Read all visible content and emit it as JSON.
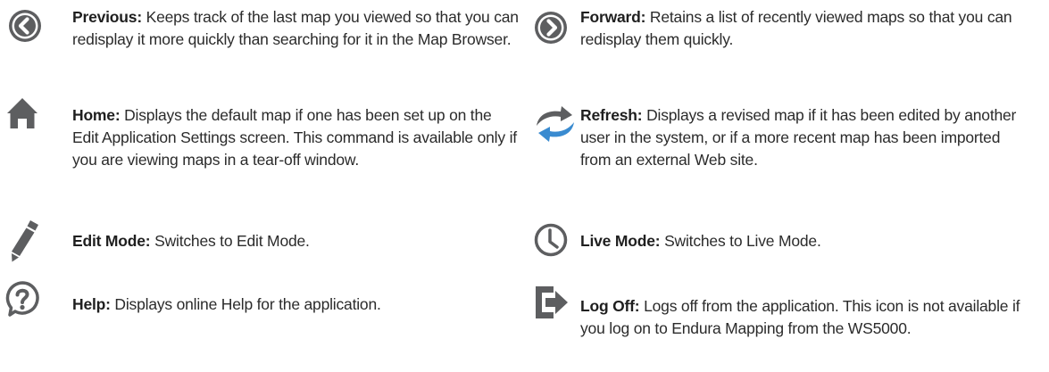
{
  "colors": {
    "icon": "#5d5e60",
    "text": "#2b2b2b"
  },
  "entries": [
    {
      "icon": "arrow-left-circle-icon",
      "term": "Previous:",
      "desc": " Keeps track of the last map you viewed so that you can redisplay it more quickly than searching for it in the Map Browser."
    },
    {
      "icon": "arrow-right-circle-icon",
      "term": "Forward:",
      "desc": " Retains a list of recently viewed maps so that you can redisplay them quickly."
    },
    {
      "icon": "home-icon",
      "term": "Home:",
      "desc": " Displays the default map if one has been set up on the Edit Application Settings screen. This command is available only if you are viewing maps in a tear-off window."
    },
    {
      "icon": "refresh-icon",
      "term": "Refresh:",
      "desc": " Displays a revised map if it has been edited by another user in the system, or if a more recent map has been imported from an external Web site."
    },
    {
      "icon": "pencil-icon",
      "term": "Edit Mode:",
      "desc": " Switches to Edit Mode."
    },
    {
      "icon": "clock-icon",
      "term": "Live Mode:",
      "desc": " Switches to Live Mode."
    },
    {
      "icon": "help-icon",
      "term": "Help:",
      "desc": " Displays online Help for the application."
    },
    {
      "icon": "log-off-icon",
      "term": "Log Off:",
      "desc": " Logs off from the application. This icon is not available if you log on to Endura Mapping from the WS5000."
    }
  ]
}
